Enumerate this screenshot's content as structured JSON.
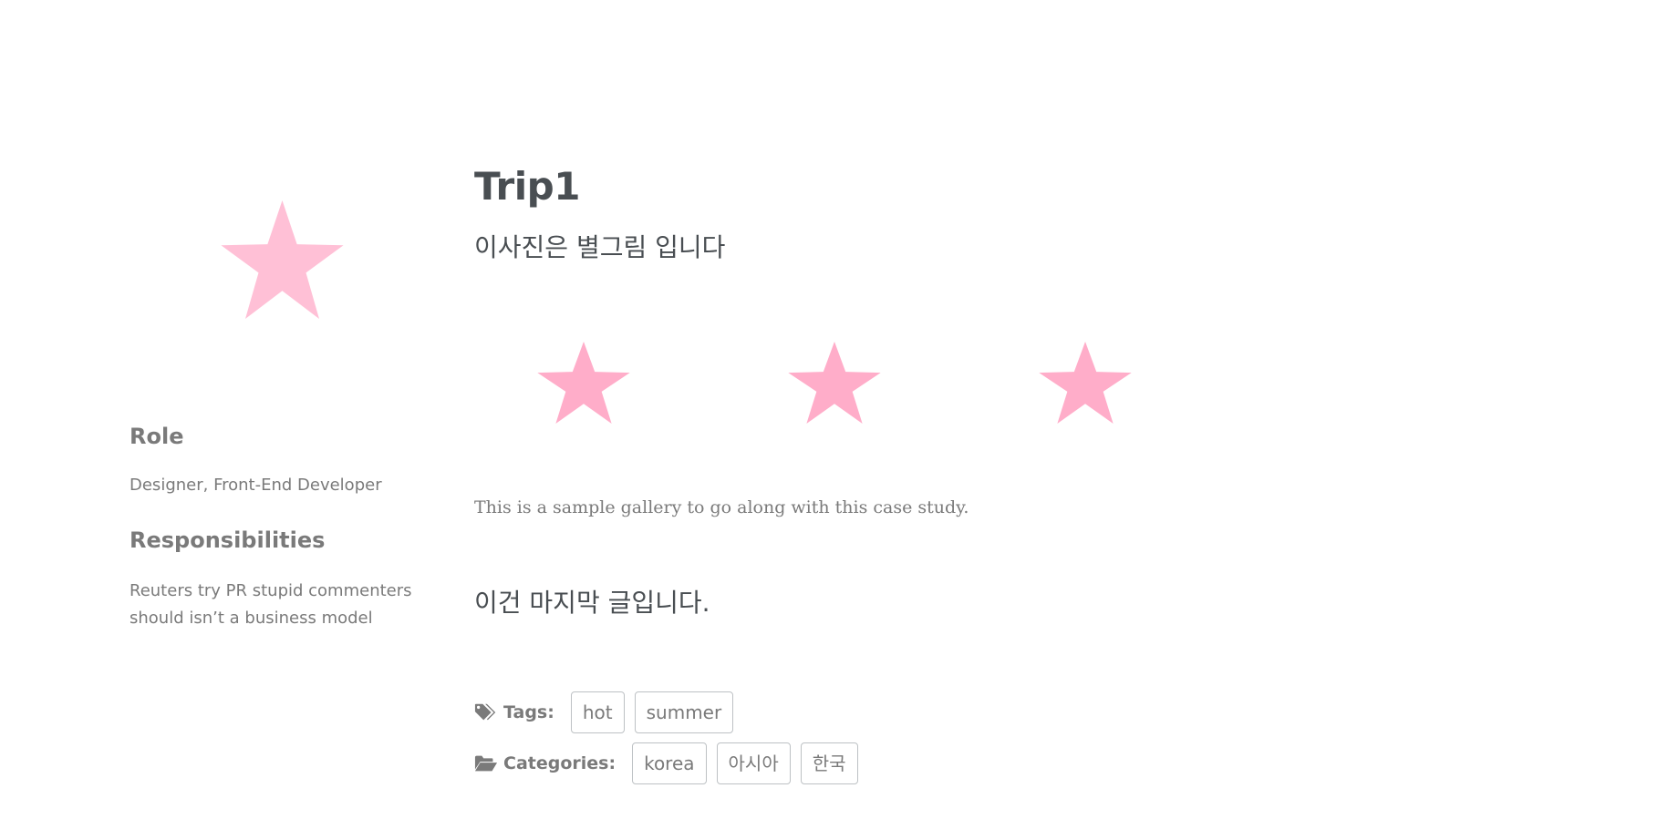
{
  "sidebar": {
    "avatar_icon": "star-icon",
    "role_heading": "Role",
    "role_text": "Designer, Front-End Developer",
    "responsibilities_heading": "Responsibilities",
    "responsibilities_text": "Reuters try PR stupid commenters should isn’t a business model"
  },
  "main": {
    "title": "Trip1",
    "subtitle": "이사진은 별그림 입니다",
    "gallery": [
      {
        "icon": "star-icon"
      },
      {
        "icon": "star-icon"
      },
      {
        "icon": "star-icon"
      }
    ],
    "caption": "This is a sample gallery to go along with this case study.",
    "closing": "이건 마지막 글입니다."
  },
  "taxonomy": {
    "tags_icon": "tags-icon",
    "tags_label": "Tags:",
    "tags": [
      "hot",
      "summer"
    ],
    "categories_icon": "folder-open-icon",
    "categories_label": "Categories:",
    "categories": [
      "korea",
      "아시아",
      "한국"
    ]
  },
  "colors": {
    "star_avatar": "#ffc0d6",
    "star_gallery": "#ffadc9",
    "text_dark": "#494e52",
    "text_muted": "#7a7a7a",
    "tag_border": "#bdc1c4"
  }
}
